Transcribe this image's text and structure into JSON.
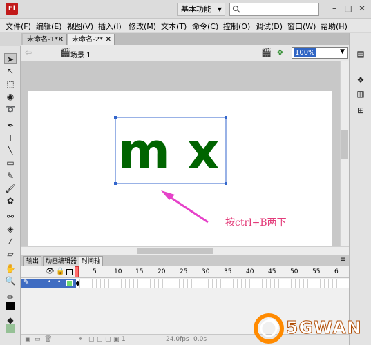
{
  "app": {
    "logo_text": "Fl",
    "workspace_label": "基本功能",
    "search_placeholder": ""
  },
  "menu": [
    "文件(F)",
    "编辑(E)",
    "视图(V)",
    "插入(I)",
    "修改(M)",
    "文本(T)",
    "命令(C)",
    "控制(O)",
    "调试(D)",
    "窗口(W)",
    "帮助(H)"
  ],
  "doc_tabs": [
    {
      "label": "未命名-1*",
      "active": false
    },
    {
      "label": "未命名-2*",
      "active": true
    }
  ],
  "editbar": {
    "scene_label": "场景 1",
    "zoom": "100%"
  },
  "stage": {
    "text": "m x",
    "text_color": "#006400",
    "selection_color": "#3366cc"
  },
  "panel_tabs": [
    {
      "label": "输出",
      "active": false
    },
    {
      "label": "动画编辑器",
      "active": false
    },
    {
      "label": "时间轴",
      "active": true
    }
  ],
  "timeline": {
    "frame_numbers": [
      "1",
      "5",
      "10",
      "15",
      "20",
      "25",
      "30",
      "35",
      "40",
      "45",
      "50",
      "55",
      "6"
    ],
    "fps": "24.0fps",
    "time": "0.0s",
    "current_frame": "1"
  },
  "annotation": {
    "text": "按ctrl+B两下",
    "color": "#e33c7a"
  },
  "watermark": {
    "text": "5GWAN"
  }
}
